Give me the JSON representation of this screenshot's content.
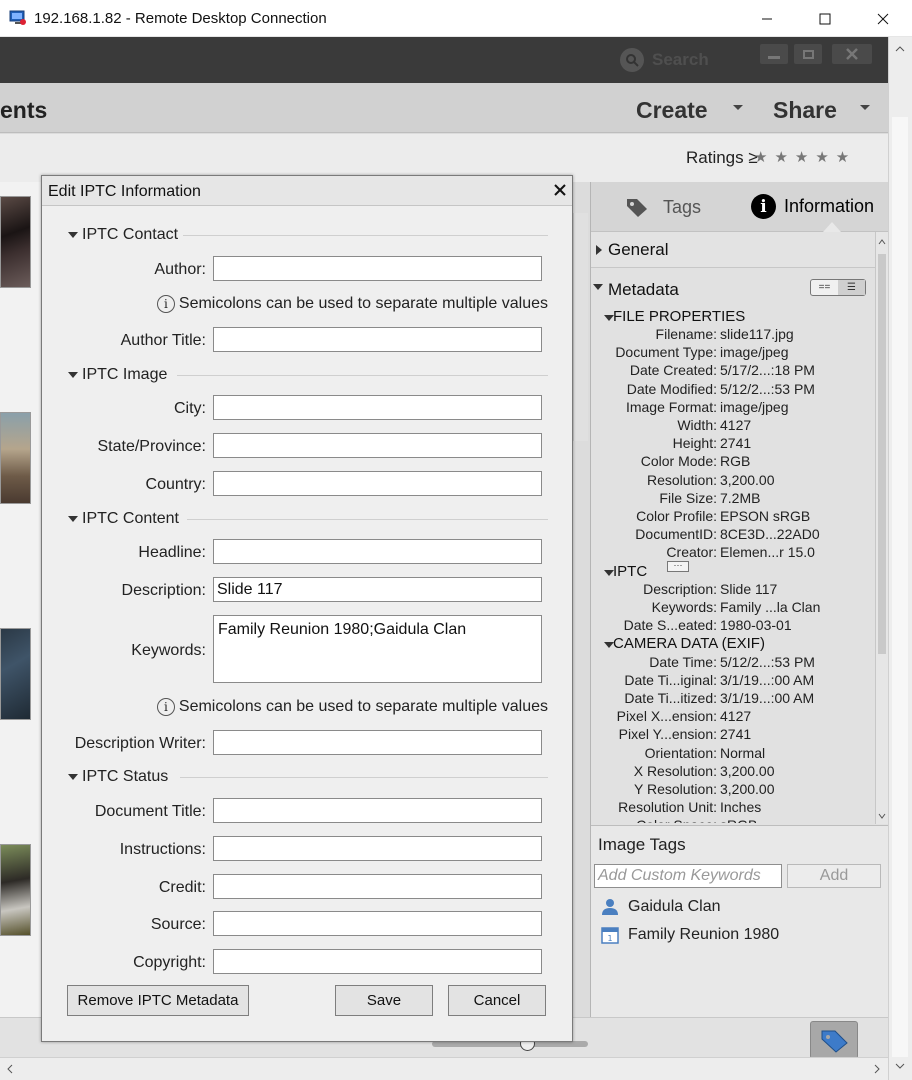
{
  "rdp": {
    "title": "192.168.1.82 - Remote Desktop Connection"
  },
  "app": {
    "search_label": "Search",
    "section_title": "ents",
    "create_label": "Create",
    "share_label": "Share",
    "ratings_label": "Ratings",
    "ratings_op": "≥",
    "stars": "★★★★★"
  },
  "dialog": {
    "title": "Edit IPTC Information",
    "sections": {
      "contact": "IPTC Contact",
      "image": "IPTC Image",
      "content": "IPTC Content",
      "status": "IPTC Status"
    },
    "labels": {
      "author": "Author:",
      "author_title": "Author Title:",
      "city": "City:",
      "state": "State/Province:",
      "country": "Country:",
      "headline": "Headline:",
      "description": "Description:",
      "keywords": "Keywords:",
      "description_writer": "Description Writer:",
      "document_title": "Document Title:",
      "instructions": "Instructions:",
      "credit": "Credit:",
      "source": "Source:",
      "copyright": "Copyright:"
    },
    "values": {
      "author": "",
      "author_title": "",
      "city": "",
      "state": "",
      "country": "",
      "headline": "",
      "description": "Slide 117",
      "keywords": "Family Reunion 1980;Gaidula Clan",
      "description_writer": "",
      "document_title": "",
      "instructions": "",
      "credit": "",
      "source": "",
      "copyright": ""
    },
    "hint": "Semicolons can be used to separate multiple values",
    "remove_btn": "Remove IPTC Metadata",
    "save_btn": "Save",
    "cancel_btn": "Cancel"
  },
  "panel": {
    "tab_tags": "Tags",
    "tab_info": "Information",
    "general": "General",
    "metadata": "Metadata",
    "groups": {
      "file": "FILE PROPERTIES",
      "iptc": "IPTC",
      "camera": "CAMERA DATA (EXIF)"
    },
    "file_props": [
      {
        "k": "Filename:",
        "v": "slide117.jpg"
      },
      {
        "k": "Document Type:",
        "v": "image/jpeg"
      },
      {
        "k": "Date Created:",
        "v": "5/17/2...:18 PM"
      },
      {
        "k": "Date Modified:",
        "v": "5/12/2...:53 PM"
      },
      {
        "k": "Image Format:",
        "v": "image/jpeg"
      },
      {
        "k": "Width:",
        "v": "4127"
      },
      {
        "k": "Height:",
        "v": "2741"
      },
      {
        "k": "Color Mode:",
        "v": "RGB"
      },
      {
        "k": "Resolution:",
        "v": "3,200.00"
      },
      {
        "k": "File Size:",
        "v": "7.2MB"
      },
      {
        "k": "Color Profile:",
        "v": "EPSON sRGB"
      },
      {
        "k": "DocumentID:",
        "v": "8CE3D...22AD0"
      },
      {
        "k": "Creator:",
        "v": "Elemen...r 15.0"
      }
    ],
    "iptc_props": [
      {
        "k": "Description:",
        "v": "Slide 117"
      },
      {
        "k": "Keywords:",
        "v": "Family ...la Clan"
      },
      {
        "k": "Date S...eated:",
        "v": "1980-03-01"
      }
    ],
    "camera_props": [
      {
        "k": "Date Time:",
        "v": "5/12/2...:53 PM"
      },
      {
        "k": "Date Ti...iginal:",
        "v": "3/1/19...:00 AM"
      },
      {
        "k": "Date Ti...itized:",
        "v": "3/1/19...:00 AM"
      },
      {
        "k": "Pixel X...ension:",
        "v": "4127"
      },
      {
        "k": "Pixel Y...ension:",
        "v": "2741"
      },
      {
        "k": "Orientation:",
        "v": "Normal"
      },
      {
        "k": "X Resolution:",
        "v": "3,200.00"
      },
      {
        "k": "Y Resolution:",
        "v": "3,200.00"
      },
      {
        "k": "Resolution Unit:",
        "v": "Inches"
      },
      {
        "k": "Color Space:",
        "v": "sRGB"
      }
    ],
    "image_tags_label": "Image Tags",
    "keyword_placeholder": "Add Custom Keywords",
    "add_btn": "Add",
    "tags": [
      {
        "name": "Gaidula Clan",
        "icon": "person-icon"
      },
      {
        "name": "Family Reunion 1980",
        "icon": "calendar-icon"
      }
    ]
  }
}
